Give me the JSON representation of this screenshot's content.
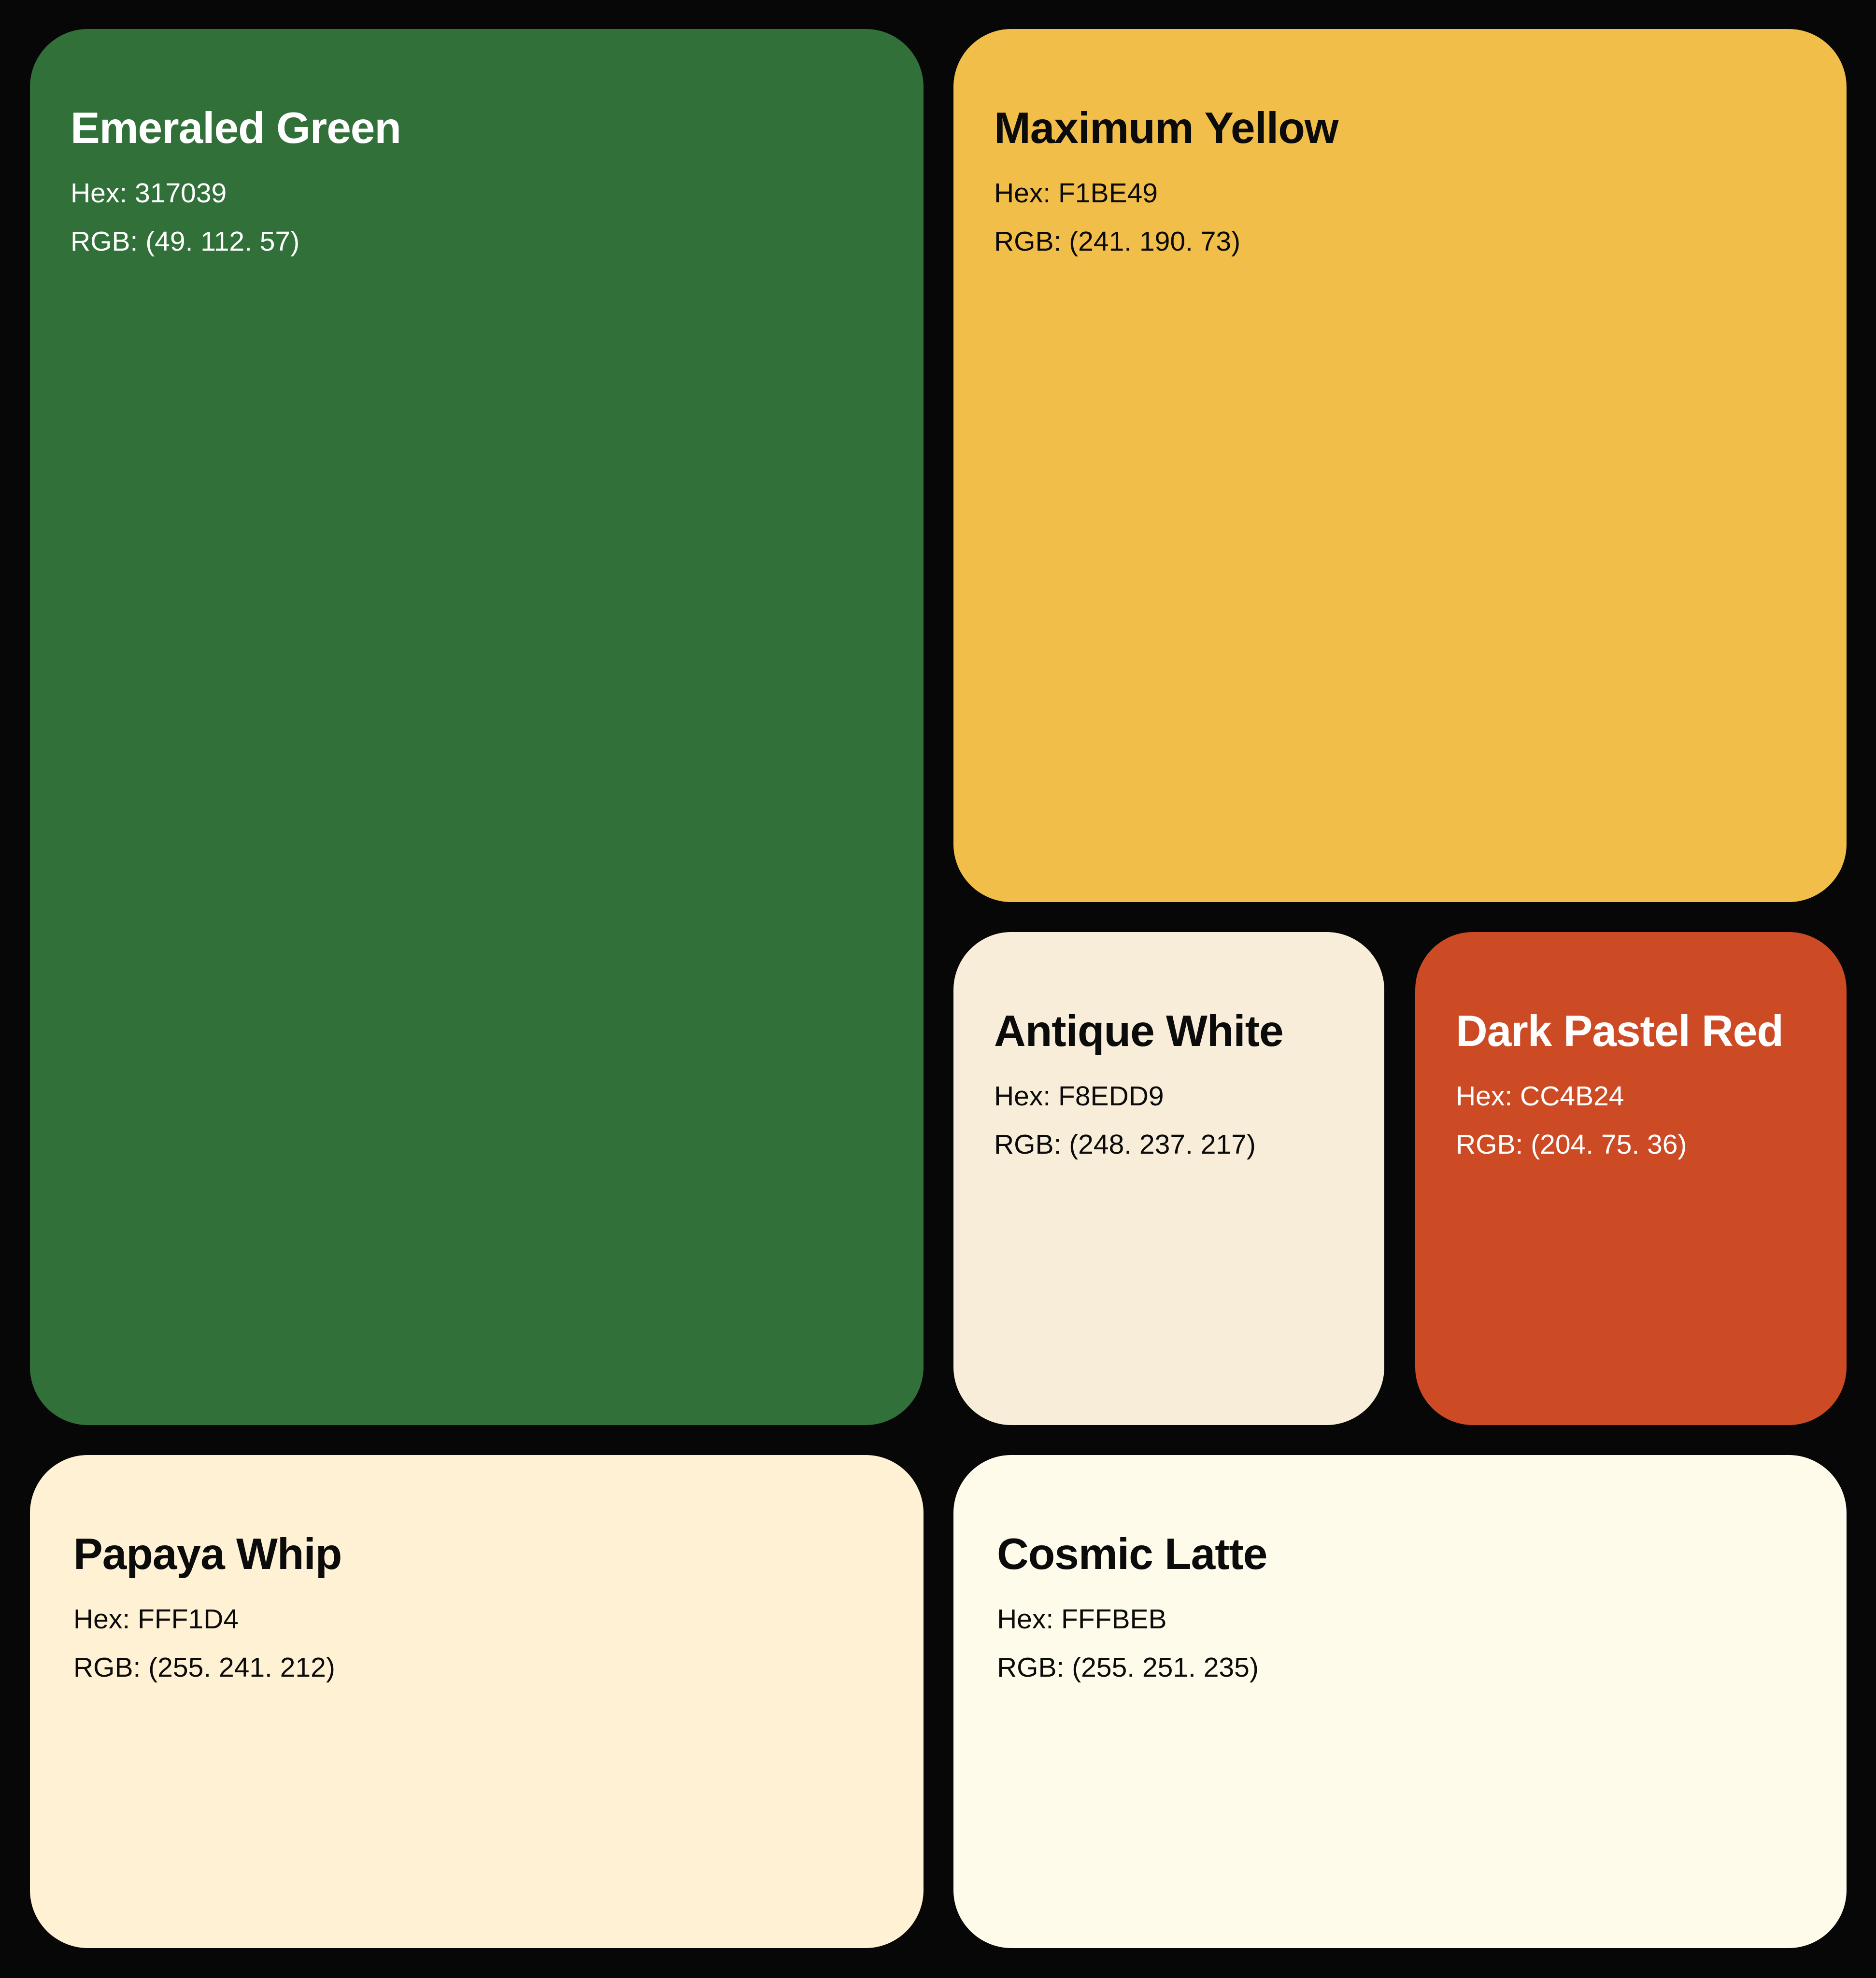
{
  "swatches": [
    {
      "name": "Emeraled Green",
      "hex_label": "Hex: 317039",
      "rgb_label": "RGB: (49. 112. 57)",
      "color": "#317039"
    },
    {
      "name": "Maximum Yellow",
      "hex_label": "Hex: F1BE49",
      "rgb_label": "RGB: (241. 190. 73)",
      "color": "#F1BE49"
    },
    {
      "name": "Antique White",
      "hex_label": "Hex: F8EDD9",
      "rgb_label": "RGB: (248. 237. 217)",
      "color": "#F8EDD9"
    },
    {
      "name": "Dark Pastel Red",
      "hex_label": "Hex: CC4B24",
      "rgb_label": "RGB: (204. 75. 36)",
      "color": "#CC4B24"
    },
    {
      "name": "Papaya Whip",
      "hex_label": "Hex: FFF1D4",
      "rgb_label": "RGB: (255. 241. 212)",
      "color": "#FFF1D4"
    },
    {
      "name": "Cosmic Latte",
      "hex_label": "Hex: FFFBEB",
      "rgb_label": "RGB: (255. 251. 235)",
      "color": "#FFFBEB"
    }
  ],
  "background_color": "#070707"
}
